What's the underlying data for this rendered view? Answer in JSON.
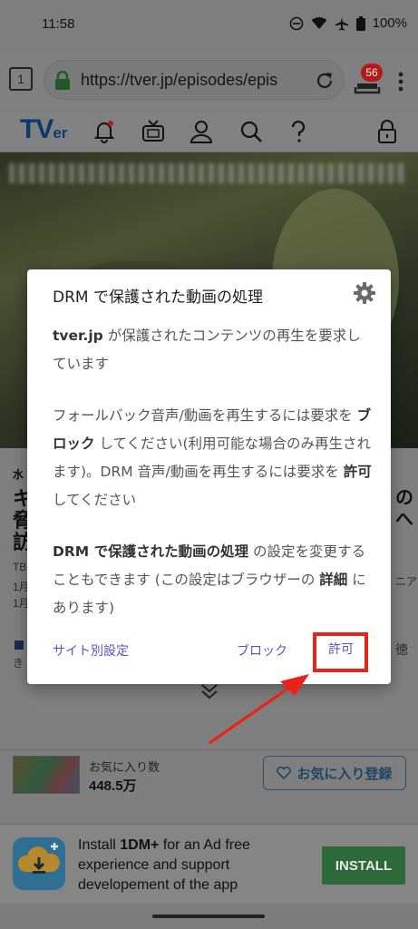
{
  "status": {
    "time": "11:58",
    "battery": "100%"
  },
  "browser": {
    "tab_count": "1",
    "url": "https://tver.jp/episodes/epis",
    "downloads_badge": "56"
  },
  "page_peek": {
    "line1": "水",
    "line2": "キ",
    "line3": "脅",
    "line4": "訪",
    "meta1": "TB",
    "meta2": "1月",
    "meta3": "1月",
    "right1": "の",
    "right2": "へ",
    "right3": "ニア",
    "right4": "徳",
    "left_small": "き"
  },
  "favorites": {
    "label": "お気に入り数",
    "count": "448.5万",
    "button_label": "お気に入り登録"
  },
  "ad": {
    "line1_prefix": "Install ",
    "line1_bold": "1DM+",
    "line1_suffix": " for an Ad free",
    "line2": "experience and support",
    "line3": "developement of the app",
    "install_label": "INSTALL"
  },
  "dialog": {
    "title": "DRM で保護された動画の処理",
    "para1_bold": "tver.jp",
    "para1_text": " が保護されたコンテンツの再生を要求しています",
    "para2_a": "フォールバック音声/動画を再生するには要求を ",
    "para2_bold1": "ブロック",
    "para2_b": " してください(利用可能な場合のみ再生されます)。DRM 音声/動画を再生するには要求を ",
    "para2_bold2": "許可",
    "para2_c": " してください",
    "para3_bold1": "DRM で保護された動画の処理",
    "para3_a": " の設定を変更することもできます (この設定はブラウザーの ",
    "para3_bold2": "詳細",
    "para3_b": " にあります)",
    "site_settings_label": "サイト別設定",
    "block_label": "ブロック",
    "allow_label": "許可"
  },
  "colors": {
    "highlight": "#e8231a",
    "link": "#5d53c0"
  }
}
